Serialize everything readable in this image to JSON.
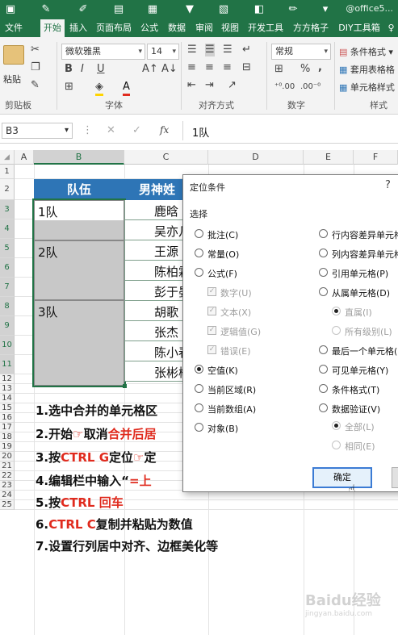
{
  "account": "@office5...",
  "tabs": [
    "文件",
    "开始",
    "插入",
    "页面布局",
    "公式",
    "数据",
    "审阅",
    "视图",
    "开发工具",
    "方方格子",
    "DIY工具箱"
  ],
  "ribbon": {
    "paste": "粘贴",
    "clipboard": "剪贴板",
    "font_name": "微软雅黑",
    "font_size": "14",
    "font_group": "字体",
    "align_group": "对齐方式",
    "number_format": "常规",
    "number_group": "数字",
    "style_conditional": "条件格式",
    "style_table": "套用表格格",
    "style_cell": "单元格样式",
    "style_group": "样式",
    "bold": "B",
    "italic": "I",
    "underline": "U",
    "font_a": "A",
    "percent": "%",
    "comma": ","
  },
  "formula_bar": {
    "name_box": "B3",
    "fx": "fx",
    "value": "1队"
  },
  "columns": [
    "A",
    "B",
    "C",
    "D",
    "E",
    "F"
  ],
  "rows": [
    "1",
    "2",
    "3",
    "4",
    "5",
    "6",
    "7",
    "8",
    "9",
    "10",
    "11",
    "12",
    "13",
    "14",
    "15",
    "16",
    "17",
    "18",
    "19",
    "20",
    "21",
    "22",
    "23",
    "24",
    "25"
  ],
  "table": {
    "header": [
      "队伍",
      "男神姓"
    ],
    "teams": [
      "1队",
      "2队",
      "3队"
    ],
    "names": [
      "鹿晗",
      "吴亦凡",
      "王源",
      "陈柏霖",
      "彭于晏",
      "胡歌",
      "张杰",
      "陈小春",
      "张彬彬"
    ]
  },
  "steps": {
    "s1": "1.选中合并的单元格区",
    "s2a": "2.开始",
    "s2b": "取消",
    "s2c": "合并后居",
    "s3a": "3.按",
    "s3b": "CTRL G",
    "s3c": "定位",
    "s3d": "定",
    "s4a": "4.编辑栏中输入“",
    "s4b": "=上",
    "s5a": "5.按",
    "s5b": "CTRL 回车",
    "s6a": "6.",
    "s6b": "CTRL C",
    "s6c": "复制并粘贴为数值",
    "s7": "7.设置行列居中对齐、边框美化等"
  },
  "dialog": {
    "title": "定位条件",
    "help": "?",
    "section": "选择",
    "left": [
      {
        "label": "批注(C)",
        "type": "radio",
        "checked": false,
        "disabled": false
      },
      {
        "label": "常量(O)",
        "type": "radio",
        "checked": false,
        "disabled": false
      },
      {
        "label": "公式(F)",
        "type": "radio",
        "checked": false,
        "disabled": false
      },
      {
        "label": "数字(U)",
        "type": "check",
        "checked": true,
        "disabled": true
      },
      {
        "label": "文本(X)",
        "type": "check",
        "checked": true,
        "disabled": true
      },
      {
        "label": "逻辑值(G)",
        "type": "check",
        "checked": true,
        "disabled": true
      },
      {
        "label": "错误(E)",
        "type": "check",
        "checked": true,
        "disabled": true
      },
      {
        "label": "空值(K)",
        "type": "radio",
        "checked": true,
        "disabled": false
      },
      {
        "label": "当前区域(R)",
        "type": "radio",
        "checked": false,
        "disabled": false
      },
      {
        "label": "当前数组(A)",
        "type": "radio",
        "checked": false,
        "disabled": false
      },
      {
        "label": "对象(B)",
        "type": "radio",
        "checked": false,
        "disabled": false
      }
    ],
    "right": [
      {
        "label": "行内容差异单元格",
        "type": "radio",
        "checked": false,
        "disabled": false
      },
      {
        "label": "列内容差异单元格",
        "type": "radio",
        "checked": false,
        "disabled": false
      },
      {
        "label": "引用单元格(P)",
        "type": "radio",
        "checked": false,
        "disabled": false
      },
      {
        "label": "从属单元格(D)",
        "type": "radio",
        "checked": false,
        "disabled": false
      },
      {
        "label": "直属(I)",
        "type": "radio",
        "checked": true,
        "disabled": true
      },
      {
        "label": "所有级别(L)",
        "type": "radio",
        "checked": false,
        "disabled": true
      },
      {
        "label": "最后一个单元格(S)",
        "type": "radio",
        "checked": false,
        "disabled": false
      },
      {
        "label": "可见单元格(Y)",
        "type": "radio",
        "checked": false,
        "disabled": false
      },
      {
        "label": "条件格式(T)",
        "type": "radio",
        "checked": false,
        "disabled": false
      },
      {
        "label": "数据验证(V)",
        "type": "radio",
        "checked": false,
        "disabled": false
      },
      {
        "label": "全部(L)",
        "type": "radio",
        "checked": true,
        "disabled": true
      },
      {
        "label": "相同(E)",
        "type": "radio",
        "checked": false,
        "disabled": true
      }
    ],
    "ok": "确定"
  },
  "watermark": {
    "brand": "Baidu经验",
    "url": "jingyan.baidu.com"
  },
  "colors": {
    "excel_green": "#217346",
    "header_blue": "#2e75b6",
    "merged_gray": "#c8c8c8",
    "red": "#e02b1e"
  }
}
